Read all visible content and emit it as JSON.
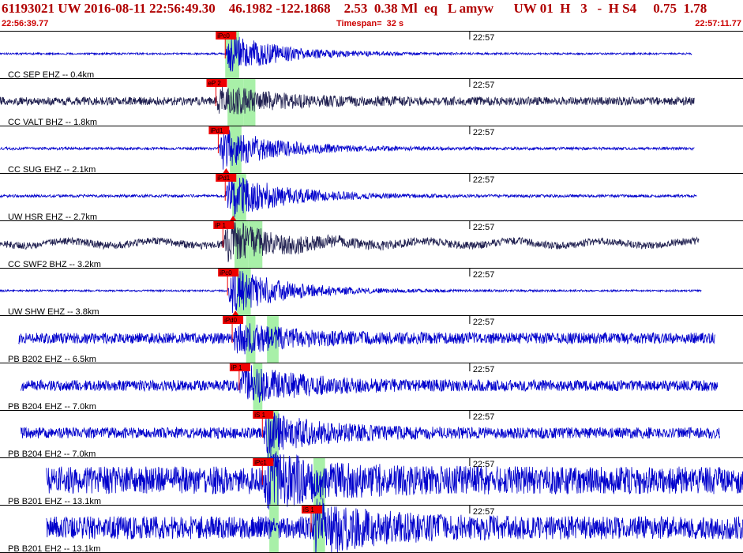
{
  "header": {
    "title_line": "61193021 UW 2016-08-11 22:56:49.30    46.1982 -122.1868    2.53  0.38 Ml  eq   L amyw      UW 01  H   3   -  H S4     0.75  1.78",
    "start_time": "22:56:39.77",
    "timespan_label": "Timespan=  32 s",
    "end_time": "22:57:11.77"
  },
  "colors": {
    "header_red": "#b00000",
    "trace_blue": "#0000cc",
    "trace_dark": "#202050",
    "pick_red": "#ee0000",
    "window_green": "#a8f0a8",
    "divider": "#000000"
  },
  "chart_data": {
    "type": "line",
    "title": "",
    "xlabel": "",
    "ylabel": "",
    "x_unit": "seconds after 22:56:39.77",
    "xlim": [
      0,
      32
    ],
    "minute_tick_label": "22:57",
    "minute_tick_time": 20.23,
    "series": [
      {
        "name": "CC SEP EHZ -- 0.4km",
        "trace_start": 0.0,
        "trace_end": 29.8,
        "color": "#0000cc",
        "pick_label": "iPc0",
        "pick_time": 9.7,
        "p_window": [
          9.7,
          10.3
        ],
        "s_window": null,
        "event_amp": 0.45,
        "noise_amp": 0.02,
        "triangle": false
      },
      {
        "name": "CC VALT BHZ -- 1.8km",
        "trace_start": 0.0,
        "trace_end": 29.9,
        "color": "#202050",
        "pick_label": "eP 2",
        "pick_time": 9.3,
        "p_window": [
          9.8,
          10.5
        ],
        "s_window": [
          10.5,
          11.0
        ],
        "event_amp": 0.32,
        "noise_amp": 0.09,
        "triangle": false
      },
      {
        "name": "CC SUG EHZ -- 2.1km",
        "trace_start": 0.0,
        "trace_end": 29.9,
        "color": "#0000cc",
        "pick_label": "iPd1",
        "pick_time": 9.4,
        "p_window": [
          9.9,
          10.4
        ],
        "s_window": null,
        "event_amp": 0.5,
        "noise_amp": 0.03,
        "triangle": true
      },
      {
        "name": "UW HSR EHZ -- 2.7km",
        "trace_start": 0.0,
        "trace_end": 30.0,
        "color": "#0000cc",
        "pick_label": "iPd1",
        "pick_time": 9.7,
        "p_window": [
          10.0,
          10.6
        ],
        "s_window": null,
        "event_amp": 0.55,
        "noise_amp": 0.03,
        "triangle": true
      },
      {
        "name": "CC SWF2 BHZ -- 3.2km",
        "trace_start": 0.0,
        "trace_end": 30.1,
        "color": "#202050",
        "pick_label": "iP 1",
        "pick_time": 9.6,
        "p_window": [
          10.1,
          10.7
        ],
        "s_window": [
          10.7,
          11.3
        ],
        "event_amp": 0.45,
        "noise_amp": 0.08,
        "triangle": false
      },
      {
        "name": "UW SHW EHZ -- 3.8km",
        "trace_start": 0.0,
        "trace_end": 30.2,
        "color": "#0000cc",
        "pick_label": "iPc0",
        "pick_time": 9.8,
        "p_window": [
          10.2,
          10.8
        ],
        "s_window": null,
        "event_amp": 0.55,
        "noise_amp": 0.02,
        "triangle": true
      },
      {
        "name": "PB B202 EHZ -- 6.5km",
        "trace_start": 0.8,
        "trace_end": 30.8,
        "color": "#0000cc",
        "pick_label": "iPd0",
        "pick_time": 10.0,
        "p_window": [
          10.6,
          11.0
        ],
        "s_window": [
          11.5,
          12.0
        ],
        "event_amp": 0.3,
        "noise_amp": 0.12,
        "triangle": false
      },
      {
        "name": "PB B204 EHZ -- 7.0km",
        "trace_start": 0.9,
        "trace_end": 30.9,
        "color": "#0000cc",
        "pick_label": "iP 1",
        "pick_time": 10.3,
        "p_window": [
          10.9,
          11.3
        ],
        "s_window": null,
        "event_amp": 0.42,
        "noise_amp": 0.12,
        "triangle": false
      },
      {
        "name": "PB B204 EH2 -- 7.0km",
        "trace_start": 0.9,
        "trace_end": 31.0,
        "color": "#0000cc",
        "pick_label": "iS 1",
        "pick_time": 11.3,
        "p_window": [
          11.5,
          12.0
        ],
        "s_window": null,
        "event_amp": 0.42,
        "noise_amp": 0.12,
        "triangle": false
      },
      {
        "name": "PB B201 EHZ -- 13.1km",
        "trace_start": 2.0,
        "trace_end": 32.0,
        "color": "#0000cc",
        "pick_label": "iPc1",
        "pick_time": 11.3,
        "p_window": [
          11.6,
          12.0
        ],
        "s_window": [
          13.5,
          14.0
        ],
        "event_amp": 0.48,
        "noise_amp": 0.3,
        "triangle": false
      },
      {
        "name": "PB B201 EH2 -- 13.1km",
        "trace_start": 2.0,
        "trace_end": 32.0,
        "color": "#0000cc",
        "pick_label": "iS 1",
        "pick_time": 13.4,
        "p_window": [
          11.6,
          12.0
        ],
        "s_window": [
          13.5,
          14.0
        ],
        "event_amp": 0.5,
        "noise_amp": 0.25,
        "triangle": false
      }
    ]
  }
}
